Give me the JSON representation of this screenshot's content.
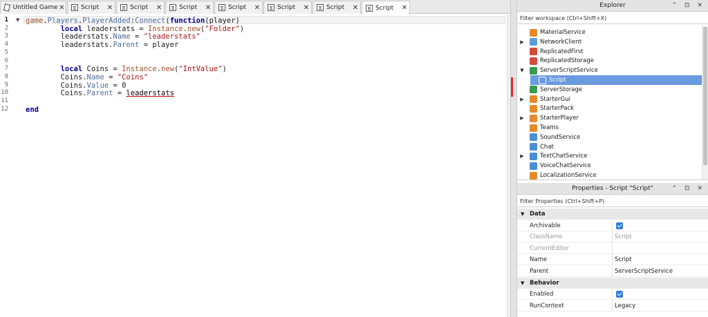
{
  "tabs": [
    {
      "label": "Untitled Game",
      "active": false,
      "icon": "studio-icon"
    },
    {
      "label": "Script",
      "active": false,
      "icon": "script-icon"
    },
    {
      "label": "Script",
      "active": false,
      "icon": "script-icon"
    },
    {
      "label": "Script",
      "active": false,
      "icon": "script-icon"
    },
    {
      "label": "Script",
      "active": false,
      "icon": "script-icon"
    },
    {
      "label": "Script",
      "active": false,
      "icon": "script-icon"
    },
    {
      "label": "Script",
      "active": false,
      "icon": "script-icon"
    },
    {
      "label": "Script",
      "active": true,
      "icon": "script-icon"
    }
  ],
  "close_glyph": "✕",
  "editor": {
    "current_line": 1,
    "line_numbers": [
      "1",
      "2",
      "3",
      "4",
      "5",
      "6",
      "7",
      "8",
      "9",
      "10",
      "11",
      "12"
    ],
    "lines": [
      [
        {
          "t": "bi",
          "s": "game"
        },
        {
          "t": "plain",
          "s": "."
        },
        {
          "t": "prop",
          "s": "Players"
        },
        {
          "t": "plain",
          "s": "."
        },
        {
          "t": "prop",
          "s": "PlayerAdded"
        },
        {
          "t": "plain",
          "s": ":"
        },
        {
          "t": "prop",
          "s": "Connect"
        },
        {
          "t": "plain",
          "s": "("
        },
        {
          "t": "kw",
          "s": "function"
        },
        {
          "t": "plain",
          "s": "(player)"
        }
      ],
      [
        {
          "t": "plain",
          "s": "        "
        },
        {
          "t": "kw",
          "s": "local"
        },
        {
          "t": "plain",
          "s": " leaderstats = "
        },
        {
          "t": "bi",
          "s": "Instance"
        },
        {
          "t": "plain",
          "s": "."
        },
        {
          "t": "bi",
          "s": "new"
        },
        {
          "t": "plain",
          "s": "("
        },
        {
          "t": "str",
          "s": "\"Folder\""
        },
        {
          "t": "plain",
          "s": ")"
        }
      ],
      [
        {
          "t": "plain",
          "s": "        leaderstats."
        },
        {
          "t": "prop",
          "s": "Name"
        },
        {
          "t": "plain",
          "s": " = "
        },
        {
          "t": "str",
          "s": "\"leaderstats\""
        }
      ],
      [
        {
          "t": "plain",
          "s": "        leaderstats."
        },
        {
          "t": "prop",
          "s": "Parent"
        },
        {
          "t": "plain",
          "s": " = player"
        }
      ],
      [],
      [],
      [
        {
          "t": "plain",
          "s": "        "
        },
        {
          "t": "kw",
          "s": "local"
        },
        {
          "t": "plain",
          "s": " Coins = "
        },
        {
          "t": "bi",
          "s": "Instance"
        },
        {
          "t": "plain",
          "s": "."
        },
        {
          "t": "bi",
          "s": "new"
        },
        {
          "t": "plain",
          "s": "("
        },
        {
          "t": "str",
          "s": "\"IntValue\""
        },
        {
          "t": "plain",
          "s": ")"
        }
      ],
      [
        {
          "t": "plain",
          "s": "        Coins."
        },
        {
          "t": "prop",
          "s": "Name"
        },
        {
          "t": "plain",
          "s": " = "
        },
        {
          "t": "str",
          "s": "\"Coins\""
        }
      ],
      [
        {
          "t": "plain",
          "s": "        Coins."
        },
        {
          "t": "prop",
          "s": "Value"
        },
        {
          "t": "plain",
          "s": " = 0"
        }
      ],
      [
        {
          "t": "plain",
          "s": "        Coins."
        },
        {
          "t": "prop",
          "s": "Parent"
        },
        {
          "t": "plain",
          "s": " = "
        },
        {
          "t": "err",
          "s": "leaderstats"
        }
      ],
      [],
      [
        {
          "t": "kw",
          "s": "end"
        }
      ]
    ],
    "folds": [
      {
        "line": 1,
        "glyph": "▼"
      }
    ]
  },
  "explorer": {
    "title": "Explorer",
    "title_controls": "⌃ ⊡ ✕",
    "filter_placeholder": "Filter workspace (Ctrl+Shift+X)",
    "items": [
      {
        "label": "MaterialService",
        "indent": 0,
        "arrow": "",
        "icon": "material-service-icon",
        "color": "#e58a2c"
      },
      {
        "label": "NetworkClient",
        "indent": 0,
        "arrow": "▶",
        "icon": "network-client-icon",
        "color": "#5aa0d8"
      },
      {
        "label": "ReplicatedFirst",
        "indent": 0,
        "arrow": "",
        "icon": "replicated-first-icon",
        "color": "#d44a3a"
      },
      {
        "label": "ReplicatedStorage",
        "indent": 0,
        "arrow": "",
        "icon": "replicated-storage-icon",
        "color": "#d44a3a"
      },
      {
        "label": "ServerScriptService",
        "indent": 0,
        "arrow": "▼",
        "icon": "server-script-service-icon",
        "color": "#3c9a4e"
      },
      {
        "label": "Script",
        "indent": 1,
        "arrow": "",
        "icon": "script-icon",
        "color": "#ffffff",
        "selected": true
      },
      {
        "label": "ServerStorage",
        "indent": 0,
        "arrow": "",
        "icon": "server-storage-icon",
        "color": "#3c9a4e"
      },
      {
        "label": "StarterGui",
        "indent": 0,
        "arrow": "▶",
        "icon": "starter-gui-icon",
        "color": "#e58a2c"
      },
      {
        "label": "StarterPack",
        "indent": 0,
        "arrow": "",
        "icon": "starter-pack-icon",
        "color": "#e58a2c"
      },
      {
        "label": "StarterPlayer",
        "indent": 0,
        "arrow": "▶",
        "icon": "starter-player-icon",
        "color": "#e58a2c"
      },
      {
        "label": "Teams",
        "indent": 0,
        "arrow": "",
        "icon": "teams-icon",
        "color": "#e58a2c"
      },
      {
        "label": "SoundService",
        "indent": 0,
        "arrow": "",
        "icon": "sound-service-icon",
        "color": "#4a8fd6"
      },
      {
        "label": "Chat",
        "indent": 0,
        "arrow": "",
        "icon": "chat-icon",
        "color": "#4a8fd6"
      },
      {
        "label": "TextChatService",
        "indent": 0,
        "arrow": "▶",
        "icon": "text-chat-service-icon",
        "color": "#4a8fd6"
      },
      {
        "label": "VoiceChatService",
        "indent": 0,
        "arrow": "",
        "icon": "voice-chat-service-icon",
        "color": "#4a8fd6"
      },
      {
        "label": "LocalizationService",
        "indent": 0,
        "arrow": "",
        "icon": "localization-service-icon",
        "color": "#e58a2c"
      }
    ]
  },
  "properties": {
    "title": "Properties - Script \"Script\"",
    "title_controls": "⌃ ⊡ ✕",
    "filter_placeholder": "Filter Properties (Ctrl+Shift+P)",
    "rows": [
      {
        "kind": "category",
        "label": "Data"
      },
      {
        "kind": "prop",
        "name": "Archivable",
        "value": "",
        "checkbox": true
      },
      {
        "kind": "prop",
        "name": "ClassName",
        "value": "Script",
        "dim": true
      },
      {
        "kind": "prop",
        "name": "CurrentEditor",
        "value": "",
        "dim": true
      },
      {
        "kind": "prop",
        "name": "Name",
        "value": "Script"
      },
      {
        "kind": "prop",
        "name": "Parent",
        "value": "ServerScriptService"
      },
      {
        "kind": "category",
        "label": "Behavior"
      },
      {
        "kind": "prop",
        "name": "Enabled",
        "value": "",
        "checkbox": true
      },
      {
        "kind": "prop",
        "name": "RunContext",
        "value": "Legacy"
      }
    ]
  },
  "colors": {
    "accent_selection": "#6a9ae0",
    "checkbox": "#2f7fd8",
    "drop_indicator": "#e8262a"
  }
}
